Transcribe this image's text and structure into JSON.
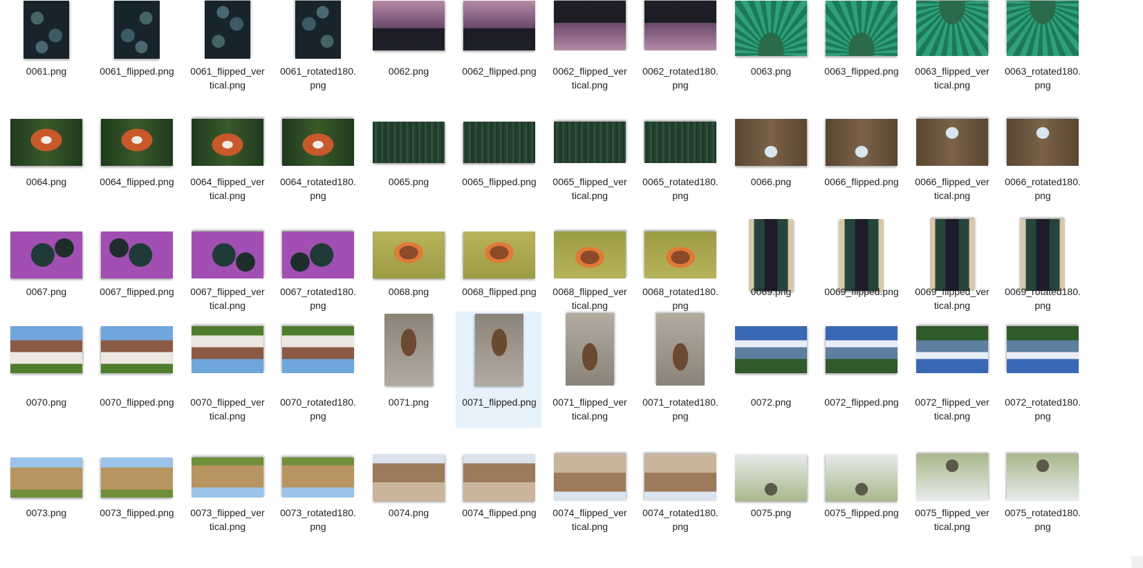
{
  "explorer": {
    "selected_file": "0071_flipped.png",
    "rows": [
      {
        "kind": "portrait-dark",
        "thumb_scheme": {
          "bg": "#1c2a33",
          "fg": "#3d5c64",
          "accent": "#6a8a8e"
        },
        "files": [
          {
            "name": "0061.png",
            "line1": "0061.png",
            "line2": "",
            "variant": "orig"
          },
          {
            "name": "0061_flipped.png",
            "line1": "0061_flipped.png",
            "line2": "",
            "variant": "h"
          },
          {
            "name": "0061_flipped_vertical.png",
            "line1": "0061_flipped_ver",
            "line2": "tical.png",
            "variant": "v"
          },
          {
            "name": "0061_rotated180.png",
            "line1": "0061_rotated180.",
            "line2": "png",
            "variant": "r"
          },
          {
            "name": "0062.png",
            "line1": "0062.png",
            "line2": "",
            "variant": "orig"
          },
          {
            "name": "0062_flipped.png",
            "line1": "0062_flipped.png",
            "line2": "",
            "variant": "h"
          },
          {
            "name": "0062_flipped_vertical.png",
            "line1": "0062_flipped_ver",
            "line2": "tical.png",
            "variant": "v"
          },
          {
            "name": "0062_rotated180.png",
            "line1": "0062_rotated180.",
            "line2": "png",
            "variant": "r"
          },
          {
            "name": "0063.png",
            "line1": "0063.png",
            "line2": "",
            "variant": "orig"
          },
          {
            "name": "0063_flipped.png",
            "line1": "0063_flipped.png",
            "line2": "",
            "variant": "h"
          },
          {
            "name": "0063_flipped_vertical.png",
            "line1": "0063_flipped_ver",
            "line2": "tical.png",
            "variant": "v"
          },
          {
            "name": "0063_rotated180.png",
            "line1": "0063_rotated180.",
            "line2": "png",
            "variant": "r"
          }
        ]
      },
      {
        "files": [
          {
            "name": "0064.png",
            "line1": "0064.png",
            "line2": "",
            "variant": "orig"
          },
          {
            "name": "0064_flipped.png",
            "line1": "0064_flipped.png",
            "line2": "",
            "variant": "h"
          },
          {
            "name": "0064_flipped_vertical.png",
            "line1": "0064_flipped_ver",
            "line2": "tical.png",
            "variant": "v"
          },
          {
            "name": "0064_rotated180.png",
            "line1": "0064_rotated180.",
            "line2": "png",
            "variant": "r"
          },
          {
            "name": "0065.png",
            "line1": "0065.png",
            "line2": "",
            "variant": "orig"
          },
          {
            "name": "0065_flipped.png",
            "line1": "0065_flipped.png",
            "line2": "",
            "variant": "h"
          },
          {
            "name": "0065_flipped_vertical.png",
            "line1": "0065_flipped_ver",
            "line2": "tical.png",
            "variant": "v"
          },
          {
            "name": "0065_rotated180.png",
            "line1": "0065_rotated180.",
            "line2": "png",
            "variant": "r"
          },
          {
            "name": "0066.png",
            "line1": "0066.png",
            "line2": "",
            "variant": "orig"
          },
          {
            "name": "0066_flipped.png",
            "line1": "0066_flipped.png",
            "line2": "",
            "variant": "h"
          },
          {
            "name": "0066_flipped_vertical.png",
            "line1": "0066_flipped_ver",
            "line2": "tical.png",
            "variant": "v"
          },
          {
            "name": "0066_rotated180.png",
            "line1": "0066_rotated180.",
            "line2": "png",
            "variant": "r"
          }
        ]
      },
      {
        "files": [
          {
            "name": "0067.png",
            "line1": "0067.png",
            "line2": "",
            "variant": "orig"
          },
          {
            "name": "0067_flipped.png",
            "line1": "0067_flipped.png",
            "line2": "",
            "variant": "h"
          },
          {
            "name": "0067_flipped_vertical.png",
            "line1": "0067_flipped_ver",
            "line2": "tical.png",
            "variant": "v"
          },
          {
            "name": "0067_rotated180.png",
            "line1": "0067_rotated180.",
            "line2": "png",
            "variant": "r"
          },
          {
            "name": "0068.png",
            "line1": "0068.png",
            "line2": "",
            "variant": "orig"
          },
          {
            "name": "0068_flipped.png",
            "line1": "0068_flipped.png",
            "line2": "",
            "variant": "h"
          },
          {
            "name": "0068_flipped_vertical.png",
            "line1": "0068_flipped_ver",
            "line2": "tical.png",
            "variant": "v"
          },
          {
            "name": "0068_rotated180.png",
            "line1": "0068_rotated180.",
            "line2": "png",
            "variant": "r"
          },
          {
            "name": "0069.png",
            "line1": "0069.png",
            "line2": "",
            "variant": "orig"
          },
          {
            "name": "0069_flipped.png",
            "line1": "0069_flipped.png",
            "line2": "",
            "variant": "h"
          },
          {
            "name": "0069_flipped_vertical.png",
            "line1": "0069_flipped_ver",
            "line2": "tical.png",
            "variant": "v"
          },
          {
            "name": "0069_rotated180.png",
            "line1": "0069_rotated180.",
            "line2": "png",
            "variant": "r"
          }
        ]
      },
      {
        "files": [
          {
            "name": "0070.png",
            "line1": "0070.png",
            "line2": "",
            "variant": "orig"
          },
          {
            "name": "0070_flipped.png",
            "line1": "0070_flipped.png",
            "line2": "",
            "variant": "h"
          },
          {
            "name": "0070_flipped_vertical.png",
            "line1": "0070_flipped_ver",
            "line2": "tical.png",
            "variant": "v"
          },
          {
            "name": "0070_rotated180.png",
            "line1": "0070_rotated180.",
            "line2": "png",
            "variant": "r"
          },
          {
            "name": "0071.png",
            "line1": "0071.png",
            "line2": "",
            "variant": "orig"
          },
          {
            "name": "0071_flipped.png",
            "line1": "0071_flipped.png",
            "line2": "",
            "variant": "h"
          },
          {
            "name": "0071_flipped_vertical.png",
            "line1": "0071_flipped_ver",
            "line2": "tical.png",
            "variant": "v"
          },
          {
            "name": "0071_rotated180.png",
            "line1": "0071_rotated180.",
            "line2": "png",
            "variant": "r"
          },
          {
            "name": "0072.png",
            "line1": "0072.png",
            "line2": "",
            "variant": "orig"
          },
          {
            "name": "0072_flipped.png",
            "line1": "0072_flipped.png",
            "line2": "",
            "variant": "h"
          },
          {
            "name": "0072_flipped_vertical.png",
            "line1": "0072_flipped_ver",
            "line2": "tical.png",
            "variant": "v"
          },
          {
            "name": "0072_rotated180.png",
            "line1": "0072_rotated180.",
            "line2": "png",
            "variant": "r"
          }
        ]
      },
      {
        "files": [
          {
            "name": "0073.png",
            "line1": "0073.png",
            "line2": "",
            "variant": "orig"
          },
          {
            "name": "0073_flipped.png",
            "line1": "0073_flipped.png",
            "line2": "",
            "variant": "h"
          },
          {
            "name": "0073_flipped_vertical.png",
            "line1": "0073_flipped_ver",
            "line2": "tical.png",
            "variant": "v"
          },
          {
            "name": "0073_rotated180.png",
            "line1": "0073_rotated180.",
            "line2": "png",
            "variant": "r"
          },
          {
            "name": "0074.png",
            "line1": "0074.png",
            "line2": "",
            "variant": "orig"
          },
          {
            "name": "0074_flipped.png",
            "line1": "0074_flipped.png",
            "line2": "",
            "variant": "h"
          },
          {
            "name": "0074_flipped_vertical.png",
            "line1": "0074_flipped_ver",
            "line2": "tical.png",
            "variant": "v"
          },
          {
            "name": "0074_rotated180.png",
            "line1": "0074_rotated180.",
            "line2": "png",
            "variant": "r"
          },
          {
            "name": "0075.png",
            "line1": "0075.png",
            "line2": "",
            "variant": "orig"
          },
          {
            "name": "0075_flipped.png",
            "line1": "0075_flipped.png",
            "line2": "",
            "variant": "h"
          },
          {
            "name": "0075_flipped_vertical.png",
            "line1": "0075_flipped_ver",
            "line2": "tical.png",
            "variant": "v"
          },
          {
            "name": "0075_rotated180.png",
            "line1": "0075_rotated180.",
            "line2": "png",
            "variant": "r"
          }
        ]
      }
    ]
  },
  "colors": {
    "selection_bg": "#e5f1fb",
    "label_text": "#1f1f1f",
    "background": "#ffffff"
  }
}
